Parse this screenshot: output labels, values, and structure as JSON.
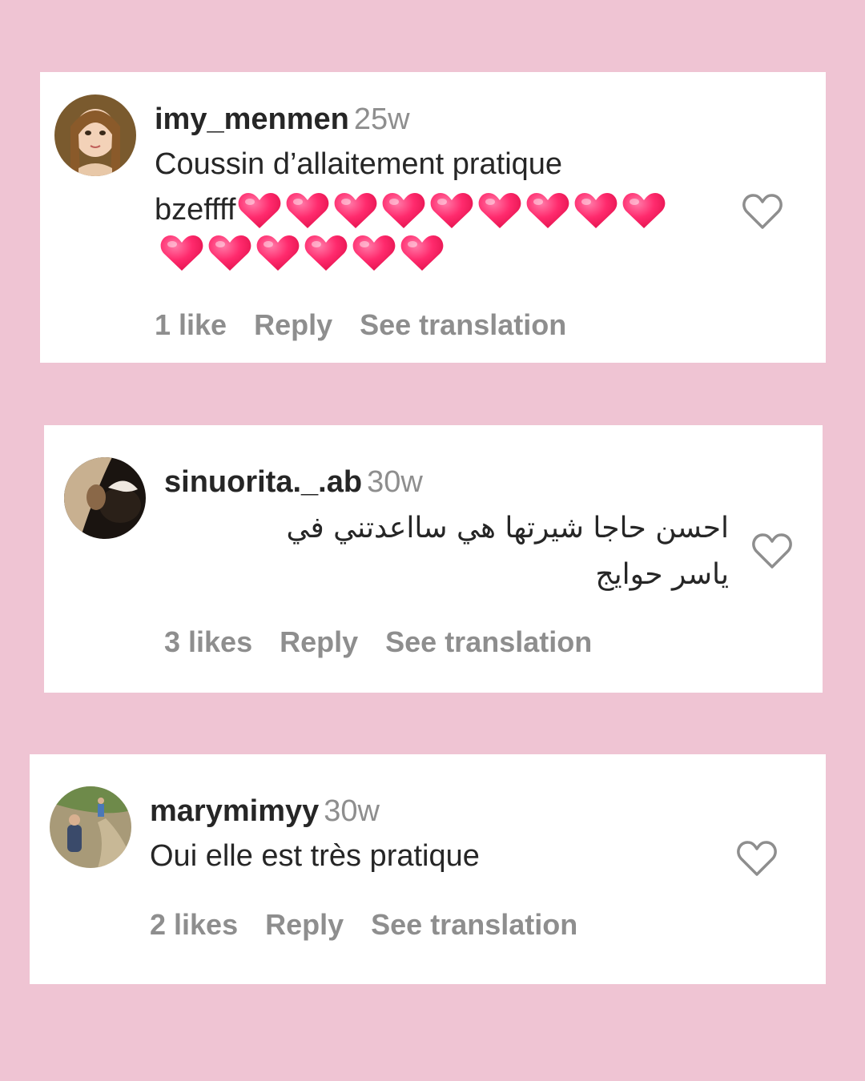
{
  "colors": {
    "background": "#efc4d3",
    "heart_emoji": "#ff2a6d",
    "muted": "#8e8e8e",
    "text": "#262626"
  },
  "comments": [
    {
      "username": "imy_menmen",
      "time": "25w",
      "text_line1": "Coussin d’allaitement pratique",
      "text_line2": "bzeffff",
      "emoji_name": "red-heart-emoji",
      "emoji_count": 15,
      "likes": "1 like",
      "reply": "Reply",
      "see_translation": "See translation"
    },
    {
      "username": "sinuorita._.ab",
      "time": "30w",
      "text_line1": "احسن حاجا شيرتها هي سااعدتني في",
      "text_line2": "ياسر حوايج",
      "likes": "3 likes",
      "reply": "Reply",
      "see_translation": "See translation"
    },
    {
      "username": "marymimyy",
      "time": "30w",
      "text_line1": "Oui elle est très pratique",
      "likes": "2 likes",
      "reply": "Reply",
      "see_translation": "See translation"
    }
  ]
}
